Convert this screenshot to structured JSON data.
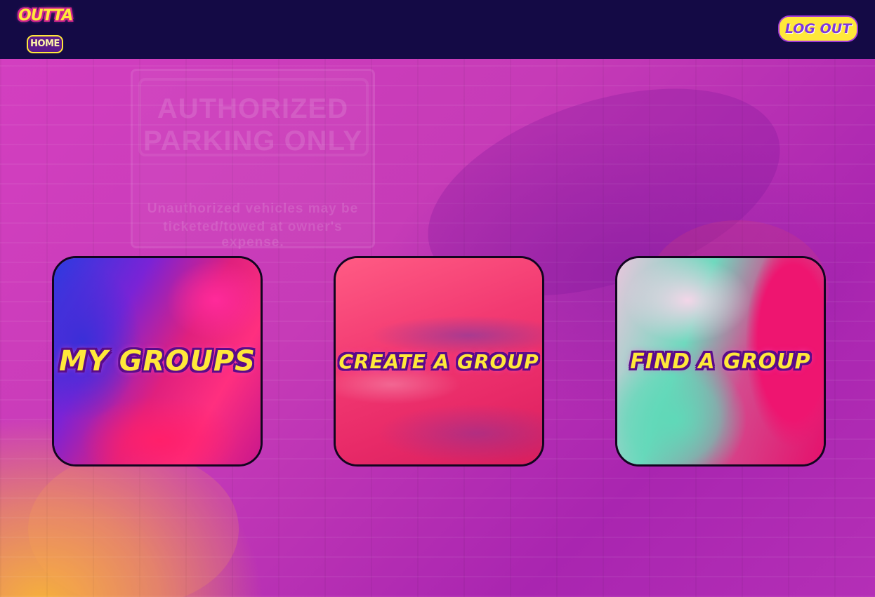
{
  "header": {
    "logo_top": "OUTTA",
    "logo_bottom": "HOME",
    "logout_label": "LOG OUT"
  },
  "background": {
    "sign_line_1": "AUTHORIZED",
    "sign_line_2": "PARKING ONLY",
    "sign_small_1": "Unauthorized vehicles may be",
    "sign_small_2": "ticketed/towed at owner's expense."
  },
  "cards": [
    {
      "label": "MY GROUPS"
    },
    {
      "label": "CREATE A GROUP"
    },
    {
      "label": "FIND A GROUP"
    }
  ],
  "colors": {
    "nav_background": "#140a45",
    "accent_yellow": "#ffe83a",
    "text_outline_purple": "#5a0b8a",
    "background_magenta": "#c63bb7"
  }
}
